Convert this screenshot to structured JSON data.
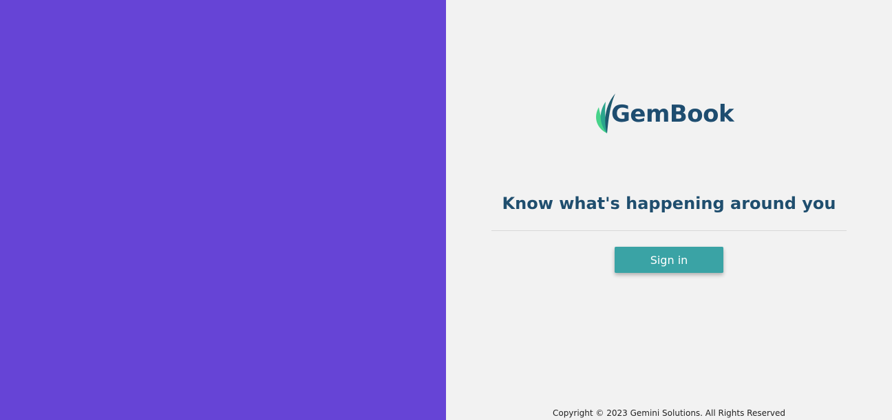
{
  "left_panel": {
    "background": "#6644d6"
  },
  "logo": {
    "text": "GemBook",
    "icon": "leaf-icon",
    "colors": {
      "text": "#1e4d70",
      "leaf_light": "#47d38a",
      "leaf_teal": "#2aa58c",
      "leaf_dark": "#1e5a6e"
    }
  },
  "main": {
    "tagline": "Know what's happening around you",
    "signin_label": "Sign in",
    "accent_color": "#3aa3a5"
  },
  "footer": {
    "copyright": "Copyright © 2023 Gemini Solutions. All Rights Reserved"
  }
}
